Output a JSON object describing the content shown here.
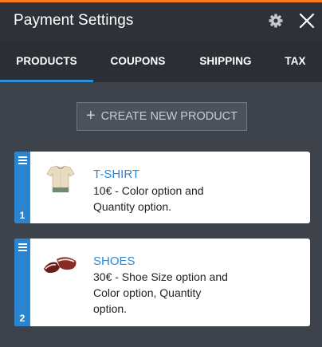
{
  "header": {
    "title": "Payment Settings",
    "settings_icon": "gear-icon",
    "close_icon": "close-icon",
    "accent_color": "#f47a20"
  },
  "tabs": [
    {
      "label": "PRODUCTS",
      "active": true
    },
    {
      "label": "COUPONS",
      "active": false
    },
    {
      "label": "SHIPPING",
      "active": false
    },
    {
      "label": "TAX",
      "active": false
    }
  ],
  "create_button": {
    "label": "CREATE NEW PRODUCT",
    "icon": "plus-icon"
  },
  "products": [
    {
      "index": "1",
      "name": "T-SHIRT",
      "description": "10€ - Color option and Quantity option.",
      "image": "tshirt-image"
    },
    {
      "index": "2",
      "name": "SHOES",
      "description": "30€ - Shoe Size option and Color option, Quantity option.",
      "image": "shoes-image"
    }
  ],
  "colors": {
    "active_tab_indicator": "#2e8ed7",
    "card_strip": "#2b84d0",
    "product_name": "#2d88d3"
  }
}
